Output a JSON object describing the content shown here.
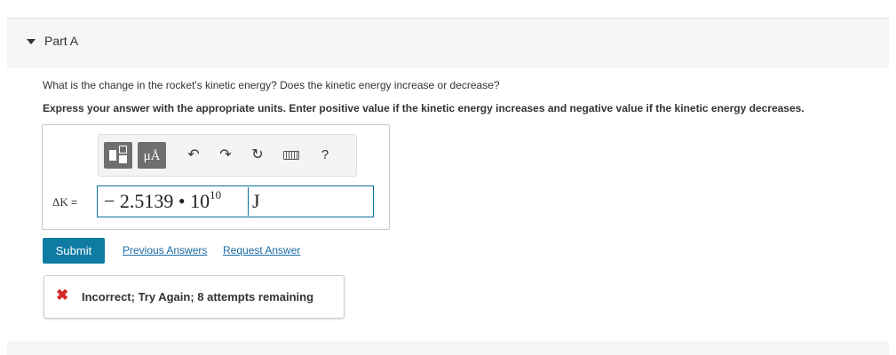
{
  "part": {
    "title": "Part A"
  },
  "question": {
    "text": "What is the change in the rocket's kinetic energy? Does the kinetic energy increase or decrease?",
    "instructions": "Express your answer with the appropriate units. Enter positive value if the kinetic energy increases and negative value if the kinetic energy decreases."
  },
  "toolbar": {
    "units_label": "μÅ",
    "help_label": "?",
    "icons": [
      "templates-icon",
      "units-icon",
      "undo-icon",
      "redo-icon",
      "reset-icon",
      "keyboard-icon",
      "help-icon"
    ]
  },
  "answer": {
    "label_var": "ΔK",
    "label_eq": "=",
    "value_mantissa": "− 2.5139",
    "value_times": "•",
    "value_base": "10",
    "value_exponent": "10",
    "unit": "J"
  },
  "actions": {
    "submit_label": "Submit",
    "previous_answers_label": "Previous Answers",
    "request_answer_label": "Request Answer"
  },
  "feedback": {
    "message": "Incorrect; Try Again; 8 attempts remaining",
    "status_color": "#d4282a"
  },
  "colors": {
    "accent": "#0f7ba3",
    "link": "#1a6aa3"
  }
}
